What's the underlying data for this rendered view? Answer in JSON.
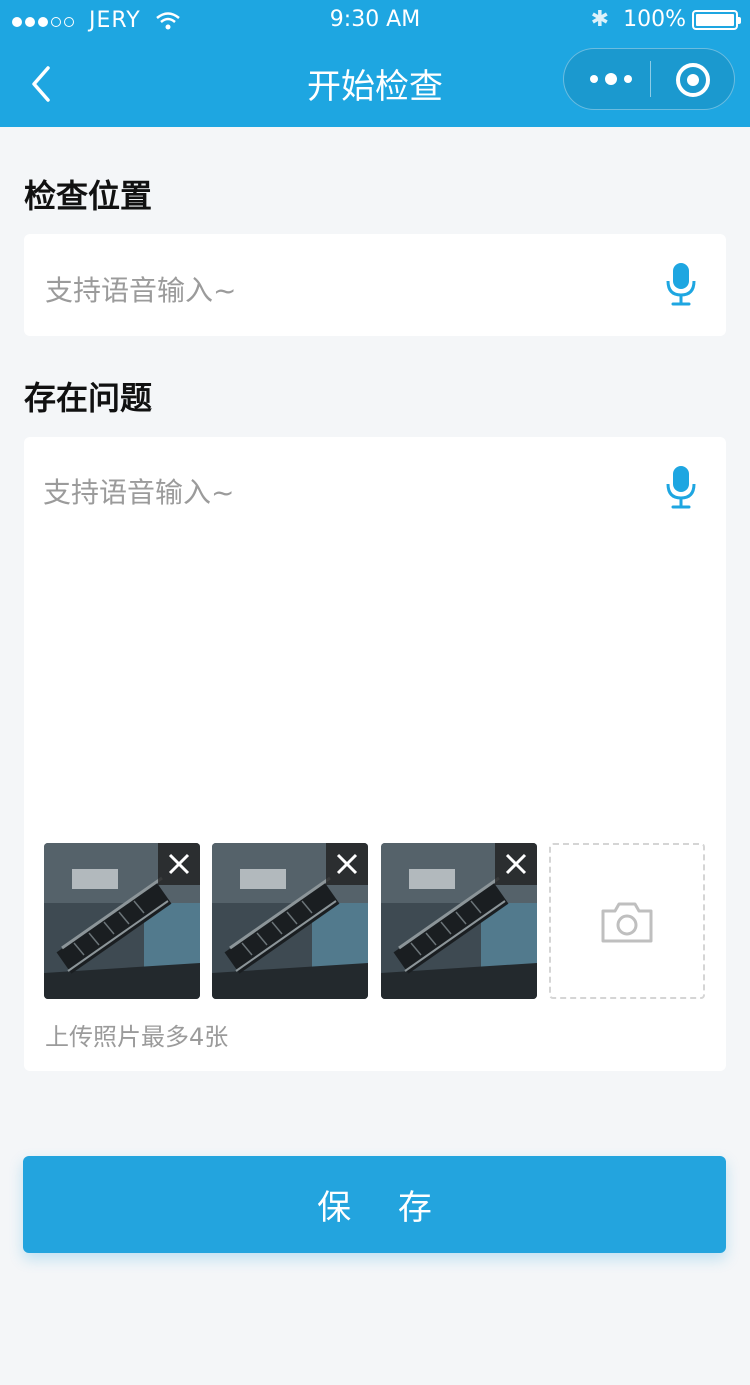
{
  "status_bar": {
    "carrier": "JERY",
    "time": "9:30 AM",
    "battery": "100%"
  },
  "nav": {
    "title": "开始检查",
    "icons": [
      "back-icon",
      "more-icon",
      "target-icon"
    ]
  },
  "form": {
    "location": {
      "label": "检查位置",
      "placeholder": "支持语音输入~",
      "value": ""
    },
    "issue": {
      "label": "存在问题",
      "placeholder": "支持语音输入~",
      "value": "",
      "photos_count": 3,
      "upload_hint": "上传照片最多4张"
    }
  },
  "save_label": "保 存",
  "colors": {
    "primary": "#1ea6e1",
    "button": "#23a4de",
    "page_bg": "#f4f6f8",
    "placeholder": "#9b9b9b"
  }
}
